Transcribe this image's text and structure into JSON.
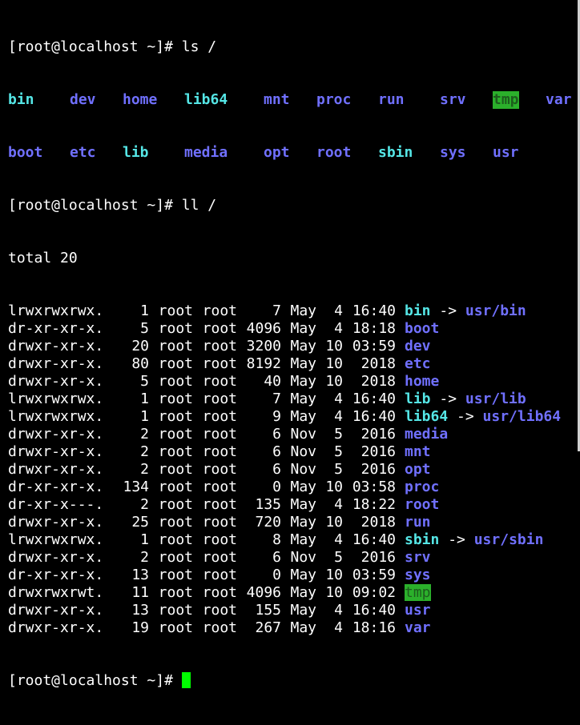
{
  "colors": {
    "background": "#000000",
    "text": "#ffffff",
    "directory": "#7070ff",
    "symlink": "#55e6e6",
    "sticky_dir_fg": "#1d5d1d",
    "sticky_dir_bg": "#2bb02b",
    "cursor": "#00ff00"
  },
  "prompt1": "[root@localhost ~]# ",
  "cmd1": "ls /",
  "ls_row1": [
    {
      "name": "bin",
      "type": "link"
    },
    {
      "name": "dev",
      "type": "dir"
    },
    {
      "name": "home",
      "type": "dir"
    },
    {
      "name": "lib64",
      "type": "link"
    },
    {
      "name": "mnt",
      "type": "dir"
    },
    {
      "name": "proc",
      "type": "dir"
    },
    {
      "name": "run",
      "type": "dir"
    },
    {
      "name": "srv",
      "type": "dir"
    },
    {
      "name": "tmp",
      "type": "tmp"
    },
    {
      "name": "var",
      "type": "dir"
    }
  ],
  "ls_row2": [
    {
      "name": "boot",
      "type": "dir"
    },
    {
      "name": "etc",
      "type": "dir"
    },
    {
      "name": "lib",
      "type": "link"
    },
    {
      "name": "media",
      "type": "dir"
    },
    {
      "name": "opt",
      "type": "dir"
    },
    {
      "name": "root",
      "type": "dir"
    },
    {
      "name": "sbin",
      "type": "link"
    },
    {
      "name": "sys",
      "type": "dir"
    },
    {
      "name": "usr",
      "type": "dir"
    }
  ],
  "prompt2": "[root@localhost ~]# ",
  "cmd2": "ll /",
  "total": "total 20",
  "entries": [
    {
      "perm": "lrwxrwxrwx.",
      "links": "1",
      "owner": "root",
      "group": "root",
      "size": "7",
      "month": "May",
      "day": "4",
      "time": "16:40",
      "name": "bin",
      "type": "link",
      "target": "usr/bin"
    },
    {
      "perm": "dr-xr-xr-x.",
      "links": "5",
      "owner": "root",
      "group": "root",
      "size": "4096",
      "month": "May",
      "day": "4",
      "time": "18:18",
      "name": "boot",
      "type": "dir",
      "target": ""
    },
    {
      "perm": "drwxr-xr-x.",
      "links": "20",
      "owner": "root",
      "group": "root",
      "size": "3200",
      "month": "May",
      "day": "10",
      "time": "03:59",
      "name": "dev",
      "type": "dir",
      "target": ""
    },
    {
      "perm": "drwxr-xr-x.",
      "links": "80",
      "owner": "root",
      "group": "root",
      "size": "8192",
      "month": "May",
      "day": "10",
      "time": "2018",
      "name": "etc",
      "type": "dir",
      "target": ""
    },
    {
      "perm": "drwxr-xr-x.",
      "links": "5",
      "owner": "root",
      "group": "root",
      "size": "40",
      "month": "May",
      "day": "10",
      "time": "2018",
      "name": "home",
      "type": "dir",
      "target": ""
    },
    {
      "perm": "lrwxrwxrwx.",
      "links": "1",
      "owner": "root",
      "group": "root",
      "size": "7",
      "month": "May",
      "day": "4",
      "time": "16:40",
      "name": "lib",
      "type": "link",
      "target": "usr/lib"
    },
    {
      "perm": "lrwxrwxrwx.",
      "links": "1",
      "owner": "root",
      "group": "root",
      "size": "9",
      "month": "May",
      "day": "4",
      "time": "16:40",
      "name": "lib64",
      "type": "link",
      "target": "usr/lib64"
    },
    {
      "perm": "drwxr-xr-x.",
      "links": "2",
      "owner": "root",
      "group": "root",
      "size": "6",
      "month": "Nov",
      "day": "5",
      "time": "2016",
      "name": "media",
      "type": "dir",
      "target": ""
    },
    {
      "perm": "drwxr-xr-x.",
      "links": "2",
      "owner": "root",
      "group": "root",
      "size": "6",
      "month": "Nov",
      "day": "5",
      "time": "2016",
      "name": "mnt",
      "type": "dir",
      "target": ""
    },
    {
      "perm": "drwxr-xr-x.",
      "links": "2",
      "owner": "root",
      "group": "root",
      "size": "6",
      "month": "Nov",
      "day": "5",
      "time": "2016",
      "name": "opt",
      "type": "dir",
      "target": ""
    },
    {
      "perm": "dr-xr-xr-x.",
      "links": "134",
      "owner": "root",
      "group": "root",
      "size": "0",
      "month": "May",
      "day": "10",
      "time": "03:58",
      "name": "proc",
      "type": "dir",
      "target": ""
    },
    {
      "perm": "dr-xr-x---.",
      "links": "2",
      "owner": "root",
      "group": "root",
      "size": "135",
      "month": "May",
      "day": "4",
      "time": "18:22",
      "name": "root",
      "type": "dir",
      "target": ""
    },
    {
      "perm": "drwxr-xr-x.",
      "links": "25",
      "owner": "root",
      "group": "root",
      "size": "720",
      "month": "May",
      "day": "10",
      "time": "2018",
      "name": "run",
      "type": "dir",
      "target": ""
    },
    {
      "perm": "lrwxrwxrwx.",
      "links": "1",
      "owner": "root",
      "group": "root",
      "size": "8",
      "month": "May",
      "day": "4",
      "time": "16:40",
      "name": "sbin",
      "type": "link",
      "target": "usr/sbin"
    },
    {
      "perm": "drwxr-xr-x.",
      "links": "2",
      "owner": "root",
      "group": "root",
      "size": "6",
      "month": "Nov",
      "day": "5",
      "time": "2016",
      "name": "srv",
      "type": "dir",
      "target": ""
    },
    {
      "perm": "dr-xr-xr-x.",
      "links": "13",
      "owner": "root",
      "group": "root",
      "size": "0",
      "month": "May",
      "day": "10",
      "time": "03:59",
      "name": "sys",
      "type": "dir",
      "target": ""
    },
    {
      "perm": "drwxrwxrwt.",
      "links": "11",
      "owner": "root",
      "group": "root",
      "size": "4096",
      "month": "May",
      "day": "10",
      "time": "09:02",
      "name": "tmp",
      "type": "tmp",
      "target": ""
    },
    {
      "perm": "drwxr-xr-x.",
      "links": "13",
      "owner": "root",
      "group": "root",
      "size": "155",
      "month": "May",
      "day": "4",
      "time": "16:40",
      "name": "usr",
      "type": "dir",
      "target": ""
    },
    {
      "perm": "drwxr-xr-x.",
      "links": "19",
      "owner": "root",
      "group": "root",
      "size": "267",
      "month": "May",
      "day": "4",
      "time": "18:16",
      "name": "var",
      "type": "dir",
      "target": ""
    }
  ],
  "prompt3": "[root@localhost ~]# ",
  "arrow": "->"
}
